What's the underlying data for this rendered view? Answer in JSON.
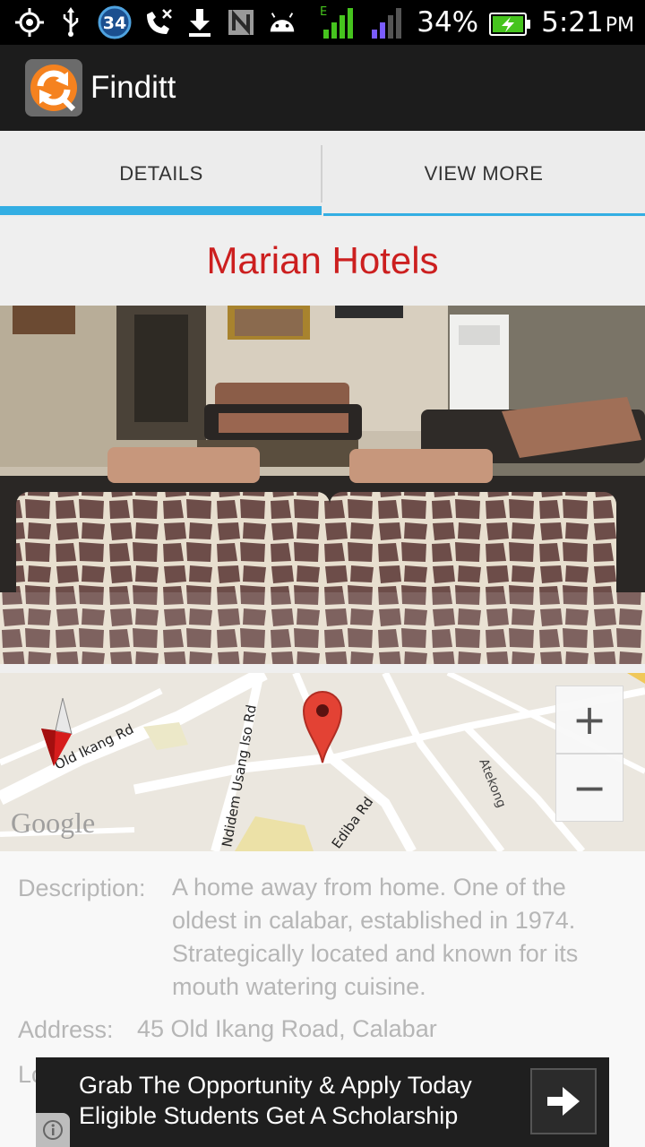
{
  "status_bar": {
    "notification_badge": "34",
    "signal_network": "E",
    "battery_percent": "34%",
    "time": "5:21",
    "ampm": "PM",
    "icons": [
      "gps-icon",
      "usb-icon",
      "notification-count-icon",
      "missed-call-icon",
      "download-icon",
      "nfc-icon",
      "android-icon",
      "signal-icon",
      "signal-icon",
      "battery-charging-icon"
    ]
  },
  "app_bar": {
    "title": "Finditt",
    "logo_icon": "finditt-logo-icon"
  },
  "tabs": [
    {
      "label": "DETAILS",
      "selected": true
    },
    {
      "label": "VIEW MORE",
      "selected": false
    }
  ],
  "hotel": {
    "name": "Marian Hotels",
    "photo_alt": "hotel lobby with sofas"
  },
  "map": {
    "streets": [
      "Old Ikang Rd",
      "Ndidem Usang Iso Rd",
      "Ediba Rd",
      "Atekong"
    ],
    "branding": "Google",
    "zoom_in": "+",
    "zoom_out": "−",
    "icons": [
      "compass-icon",
      "map-pin-icon",
      "zoom-in-icon",
      "zoom-out-icon"
    ]
  },
  "details": {
    "description_label": "Description:",
    "description_lines": [
      "A home away from home. One of the",
      "oldest in calabar, established in 1974.",
      "Strategically located and known for its",
      "mouth watering cuisine."
    ],
    "address_label": "Address:",
    "address_value": "45 Old Ikang Road, Calabar",
    "partial_label": "Lo"
  },
  "ad": {
    "line1": "Grab The Opportunity & Apply Today",
    "line2": "Eligible Students Get A Scholarship",
    "arrow_icon": "arrow-right-icon",
    "info_icon": "info-icon"
  },
  "colors": {
    "accent": "#33aee3",
    "title": "#cc1f1f",
    "appbar": "#1c1c1c",
    "logo_orange": "#f5821f"
  }
}
